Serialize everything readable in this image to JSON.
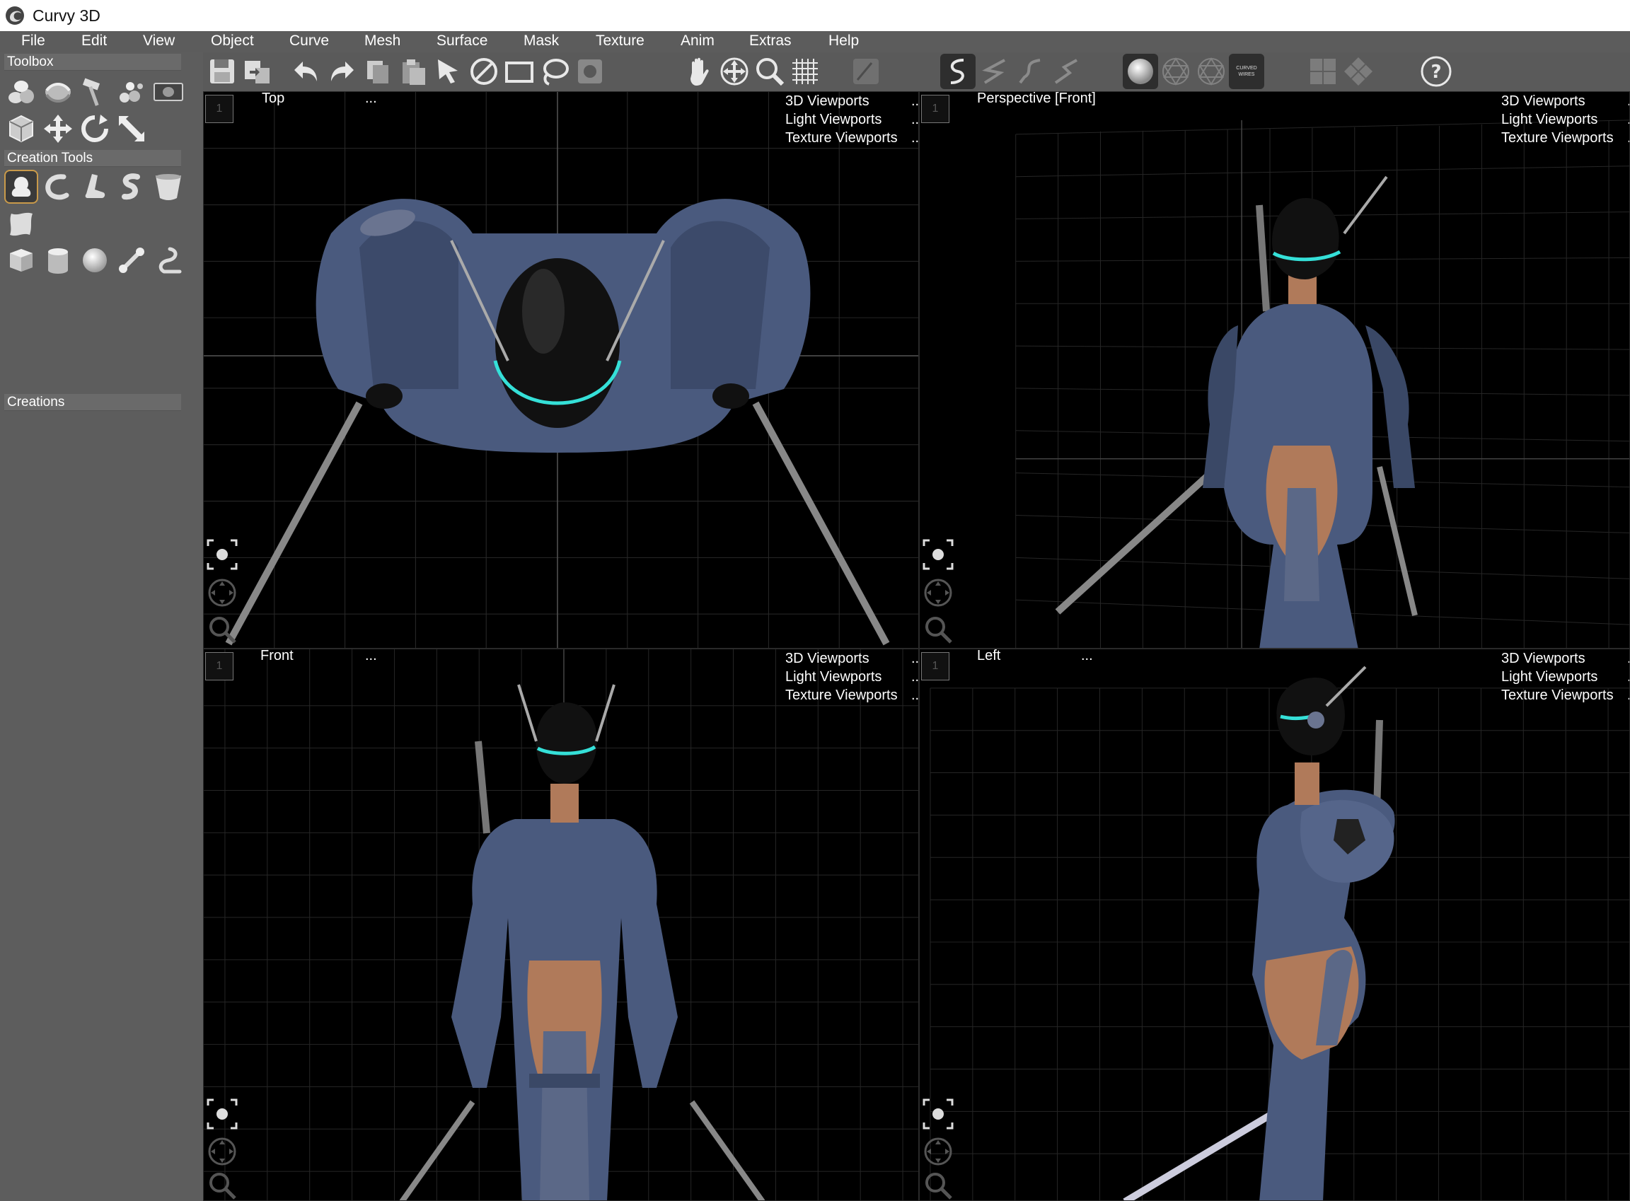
{
  "app": {
    "title": "Curvy 3D",
    "logo_icon": "curvy-swirl-icon"
  },
  "menu": [
    "File",
    "Edit",
    "View",
    "Object",
    "Curve",
    "Mesh",
    "Surface",
    "Mask",
    "Texture",
    "Anim",
    "Extras",
    "Help"
  ],
  "toolbar": {
    "icons": [
      "save-icon",
      "export-icon",
      "undo-icon",
      "redo-icon",
      "copy-icon",
      "paste-icon",
      "select-arrow-icon",
      "deselect-icon",
      "rect-select-icon",
      "lasso-select-icon",
      "mask-select-icon",
      "pan-hand-icon",
      "move-view-icon",
      "zoom-icon",
      "grid-icon",
      "edit-disabled-icon",
      "curve-tool-1-icon",
      "curve-tool-2-icon",
      "curve-tool-3-icon",
      "curve-tool-4-icon",
      "shaded-sphere-icon",
      "wire-sphere-icon",
      "wire-sphere-2-icon",
      "curved-wires-icon",
      "flat-view-icon",
      "rotated-view-icon",
      "help-icon"
    ],
    "curved_wires_label": "CURVED WIRES"
  },
  "toolbox": {
    "header": "Toolbox",
    "creation_tools_header": "Creation Tools",
    "creations_header": "Creations"
  },
  "viewports": [
    {
      "id": "top",
      "label": "Top",
      "dots": "...",
      "menu": [
        "3D Viewports",
        "Light Viewports",
        "Texture Viewports"
      ],
      "badge": "1"
    },
    {
      "id": "perspective",
      "label": "Perspective [Front]",
      "dots": "",
      "menu": [
        "3D Viewports",
        "Light Viewports",
        "Texture Viewports"
      ],
      "badge": "1"
    },
    {
      "id": "front",
      "label": "Front",
      "dots": "...",
      "menu": [
        "3D Viewports",
        "Light Viewports",
        "Texture Viewports"
      ],
      "badge": "1"
    },
    {
      "id": "left",
      "label": "Left",
      "dots": "...",
      "menu": [
        "3D Viewports",
        "Light Viewports",
        "Texture Viewports"
      ],
      "badge": "1"
    }
  ],
  "menu_trailing_dots": "..",
  "colors": {
    "accent_cyan": "#35e0d8",
    "armor_blue": "#4a5a7e",
    "selected_border": "#c99a4a",
    "panel_gray": "#5d5d5d"
  }
}
